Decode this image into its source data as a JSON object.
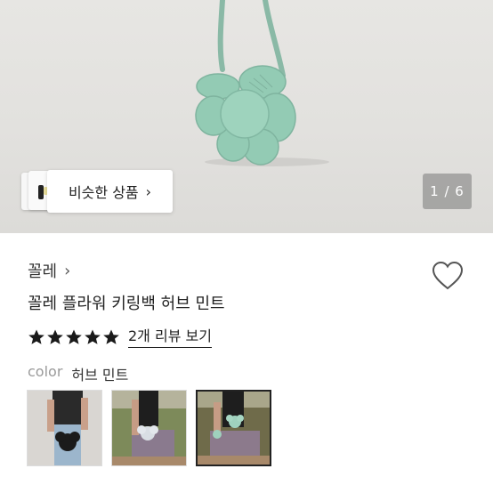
{
  "hero": {
    "image_description_icon": "product-photo",
    "counter": "1 / 6",
    "similar_button_label": "비슷한 상품",
    "similar_chevron": "›"
  },
  "product": {
    "shop_name": "꼴레",
    "shop_chevron": "›",
    "title": "꼴레 플라워 키링백 허브 민트",
    "rating_stars": 5,
    "review_link": "2개 리뷰 보기",
    "color_label": "color",
    "color_value": "허브 민트"
  },
  "options": [
    {
      "name": "option-black"
    },
    {
      "name": "option-white"
    },
    {
      "name": "option-mint",
      "selected": true
    }
  ],
  "colors": {
    "mint": "#8fc9b2",
    "star": "#1a1a1a"
  }
}
